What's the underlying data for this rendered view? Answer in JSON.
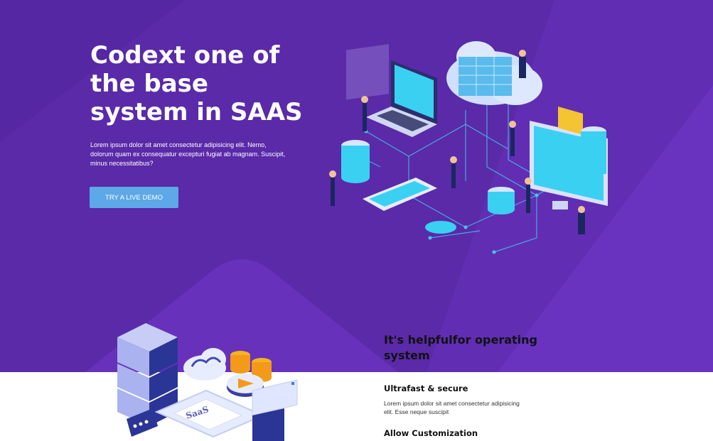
{
  "hero": {
    "title": "Codext one of the base system in SAAS",
    "description": "Lorem ipsum dolor sit amet consectetur adipisicing elit. Nemo, dolorum quam ex consequatur excepturi fugiat ab magnam. Suscipit, minus necessitatibus?",
    "cta_label": "TRY A LIVE DEMO"
  },
  "features": {
    "heading": "It's helpfulfor operating system",
    "items": [
      {
        "title": "Ultrafast & secure",
        "description": "Lorem ipsum dolor sit amet consectetur adipisicing elit. Esse neque suscipit"
      },
      {
        "title": "Allow Customization",
        "description": ""
      }
    ]
  },
  "illustrations": {
    "saas_label": "SaaS"
  },
  "colors": {
    "hero_bg": "#5a2aa8",
    "hero_bg_light": "#6a33c0",
    "accent_blue": "#5da8e6",
    "cyan": "#3fd1f0"
  }
}
